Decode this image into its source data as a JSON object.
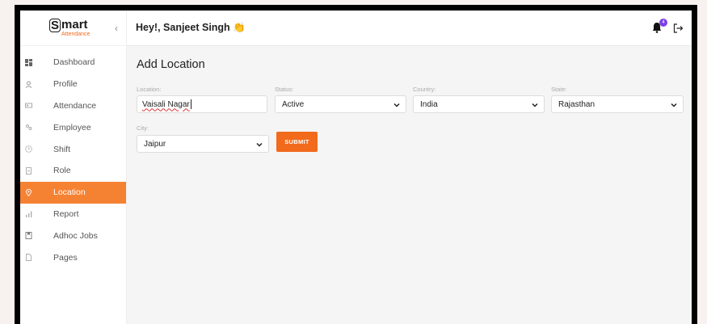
{
  "app": {
    "logo_s": "S",
    "logo_main": "mart",
    "logo_sub": "Attendance",
    "collapse_glyph": "‹"
  },
  "sidebar": {
    "items": [
      {
        "label": "Dashboard",
        "icon": "dashboard-icon",
        "active": false
      },
      {
        "label": "Profile",
        "icon": "profile-icon",
        "active": false
      },
      {
        "label": "Attendance",
        "icon": "attendance-icon",
        "active": false
      },
      {
        "label": "Employee",
        "icon": "employee-icon",
        "active": false
      },
      {
        "label": "Shift",
        "icon": "clock-icon",
        "active": false
      },
      {
        "label": "Role",
        "icon": "role-icon",
        "active": false
      },
      {
        "label": "Location",
        "icon": "location-pin-icon",
        "active": true
      },
      {
        "label": "Report",
        "icon": "bar-chart-icon",
        "active": false
      },
      {
        "label": "Adhoc Jobs",
        "icon": "bookmark-icon",
        "active": false
      },
      {
        "label": "Pages",
        "icon": "page-icon",
        "active": false
      }
    ]
  },
  "header": {
    "greeting": "Hey!, Sanjeet Singh 👏",
    "notification_count": "4"
  },
  "form": {
    "title": "Add Location",
    "location_label": "Location:",
    "location_value": "Vaisali Nagar",
    "status_label": "Status:",
    "status_value": "Active",
    "country_label": "Country:",
    "country_value": "India",
    "state_label": "State:",
    "state_value": "Rajasthan",
    "city_label": "City:",
    "city_value": "Jaipur",
    "submit_label": "SUBMIT"
  },
  "colors": {
    "accent": "#f58233",
    "button": "#f26a1b",
    "badge": "#7b3fe4"
  }
}
